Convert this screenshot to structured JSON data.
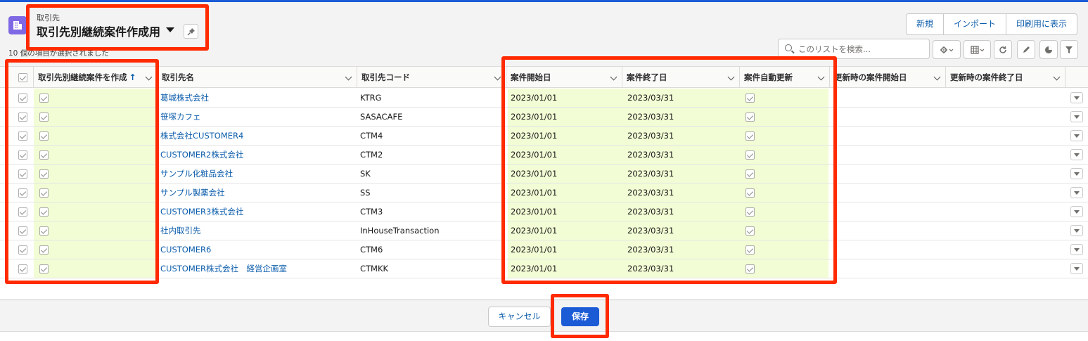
{
  "header": {
    "object_type": "取引先",
    "list_title": "取引先別継続案件作成用",
    "selection_status": "10 個の項目が選択されました",
    "buttons": [
      "新規",
      "インポート",
      "印刷用に表示"
    ],
    "search_placeholder": "このリストを検索..."
  },
  "toolbar_icons": [
    "settings-icon",
    "table-view-icon",
    "refresh-icon",
    "edit-icon",
    "chart-icon",
    "filter-icon"
  ],
  "columns": [
    "取引先別継続案件を作成",
    "取引先名",
    "取引先コード",
    "案件開始日",
    "案件終了日",
    "案件自動更新",
    "更新時の案件開始日",
    "更新時の案件終了日"
  ],
  "sort_arrow": "↑",
  "rows": [
    {
      "name": "葛城株式会社",
      "code": "KTRG",
      "start": "2023/01/01",
      "end": "2023/03/31"
    },
    {
      "name": "笹塚カフェ",
      "code": "SASACAFE",
      "start": "2023/01/01",
      "end": "2023/03/31"
    },
    {
      "name": "株式会社CUSTOMER4",
      "code": "CTM4",
      "start": "2023/01/01",
      "end": "2023/03/31"
    },
    {
      "name": "CUSTOMER2株式会社",
      "code": "CTM2",
      "start": "2023/01/01",
      "end": "2023/03/31"
    },
    {
      "name": "サンプル化粧品会社",
      "code": "SK",
      "start": "2023/01/01",
      "end": "2023/03/31"
    },
    {
      "name": "サンプル製薬会社",
      "code": "SS",
      "start": "2023/01/01",
      "end": "2023/03/31"
    },
    {
      "name": "CUSTOMER3株式会社",
      "code": "CTM3",
      "start": "2023/01/01",
      "end": "2023/03/31"
    },
    {
      "name": "社内取引先",
      "code": "InHouseTransaction",
      "start": "2023/01/01",
      "end": "2023/03/31"
    },
    {
      "name": "CUSTOMER6",
      "code": "CTM6",
      "start": "2023/01/01",
      "end": "2023/03/31"
    },
    {
      "name": "CUSTOMER株式会社　経営企画室",
      "code": "CTMKK",
      "start": "2023/01/01",
      "end": "2023/03/31"
    }
  ],
  "footer": {
    "cancel_label": "キャンセル",
    "save_label": "保存"
  },
  "colors": {
    "highlight": "#f2fdd5",
    "annotation": "#ff2a00",
    "brand_blue": "#1b5bd6",
    "link": "#0b5cab"
  }
}
